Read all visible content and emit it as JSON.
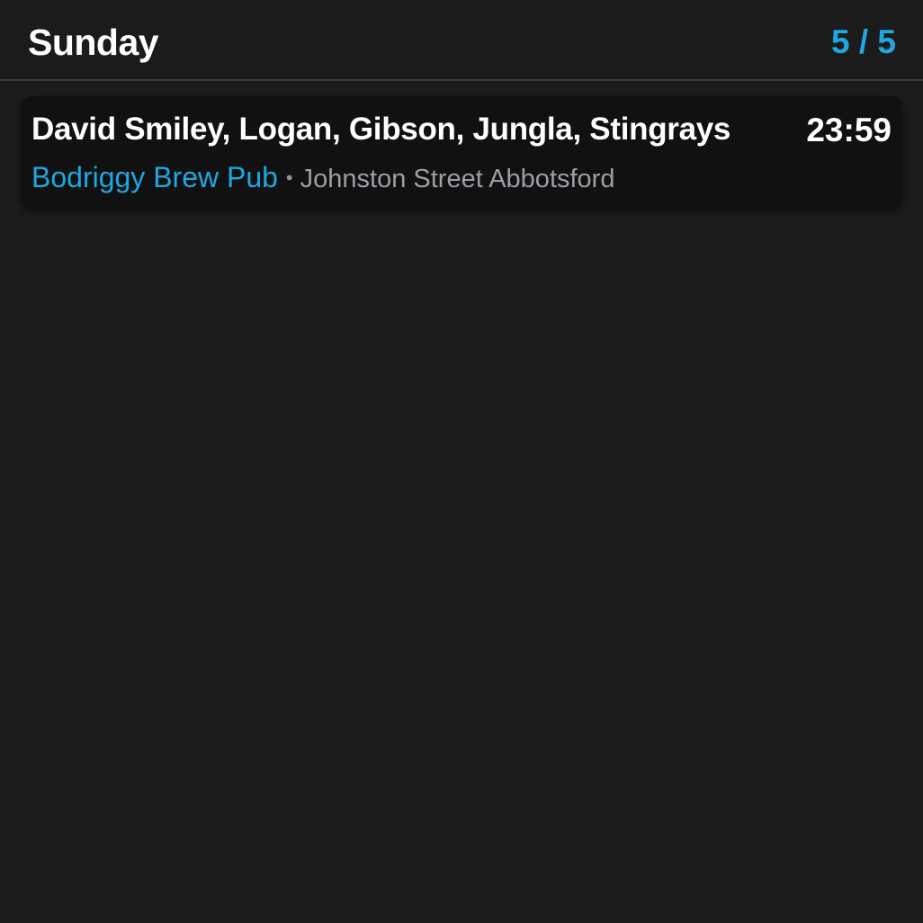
{
  "header": {
    "day": "Sunday",
    "counter": "5 / 5"
  },
  "gigs": [
    {
      "acts": "David Smiley, Logan, Gibson, Jungla, Stingrays",
      "time": "23:59",
      "venue": "Bodriggy Brew Pub",
      "separator": "•",
      "address": "Johnston Street Abbotsford"
    }
  ],
  "colors": {
    "background": "#1b1b1b",
    "card": "#111111",
    "accent": "#1ea7e0",
    "muted": "#9c9ea6"
  }
}
